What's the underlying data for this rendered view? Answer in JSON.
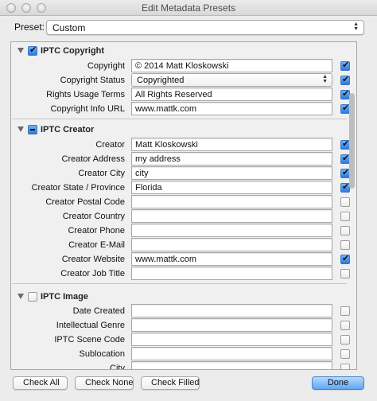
{
  "window": {
    "title": "Edit Metadata Presets"
  },
  "preset": {
    "label": "Preset:",
    "value": "Custom"
  },
  "sections": {
    "copyright": {
      "title": "IPTC Copyright",
      "rows": [
        {
          "label": "Copyright",
          "value": "© 2014 Matt Kloskowski"
        },
        {
          "label": "Copyright Status",
          "value": "Copyrighted"
        },
        {
          "label": "Rights Usage Terms",
          "value": "All Rights Reserved"
        },
        {
          "label": "Copyright Info URL",
          "value": "www.mattk.com"
        }
      ]
    },
    "creator": {
      "title": "IPTC Creator",
      "rows": [
        {
          "label": "Creator",
          "value": "Matt Kloskowski"
        },
        {
          "label": "Creator Address",
          "value": "my address"
        },
        {
          "label": "Creator City",
          "value": "city"
        },
        {
          "label": "Creator State / Province",
          "value": "Florida"
        },
        {
          "label": "Creator Postal Code",
          "value": ""
        },
        {
          "label": "Creator Country",
          "value": ""
        },
        {
          "label": "Creator Phone",
          "value": ""
        },
        {
          "label": "Creator E-Mail",
          "value": ""
        },
        {
          "label": "Creator Website",
          "value": "www.mattk.com"
        },
        {
          "label": "Creator Job Title",
          "value": ""
        }
      ]
    },
    "image": {
      "title": "IPTC Image",
      "rows": [
        {
          "label": "Date Created",
          "value": ""
        },
        {
          "label": "Intellectual Genre",
          "value": ""
        },
        {
          "label": "IPTC Scene Code",
          "value": ""
        },
        {
          "label": "Sublocation",
          "value": ""
        },
        {
          "label": "City",
          "value": ""
        }
      ]
    }
  },
  "buttons": {
    "check_all": "Check All",
    "check_none": "Check None",
    "check_filled": "Check Filled",
    "done": "Done"
  },
  "colors": {
    "accent": "#2d7ae0",
    "done_button": "#5ea6f5"
  },
  "icons": {
    "disclosure": "disclosure-triangle-icon",
    "select": "up-down-arrows-icon",
    "checkbox": "checkmark-icon"
  }
}
